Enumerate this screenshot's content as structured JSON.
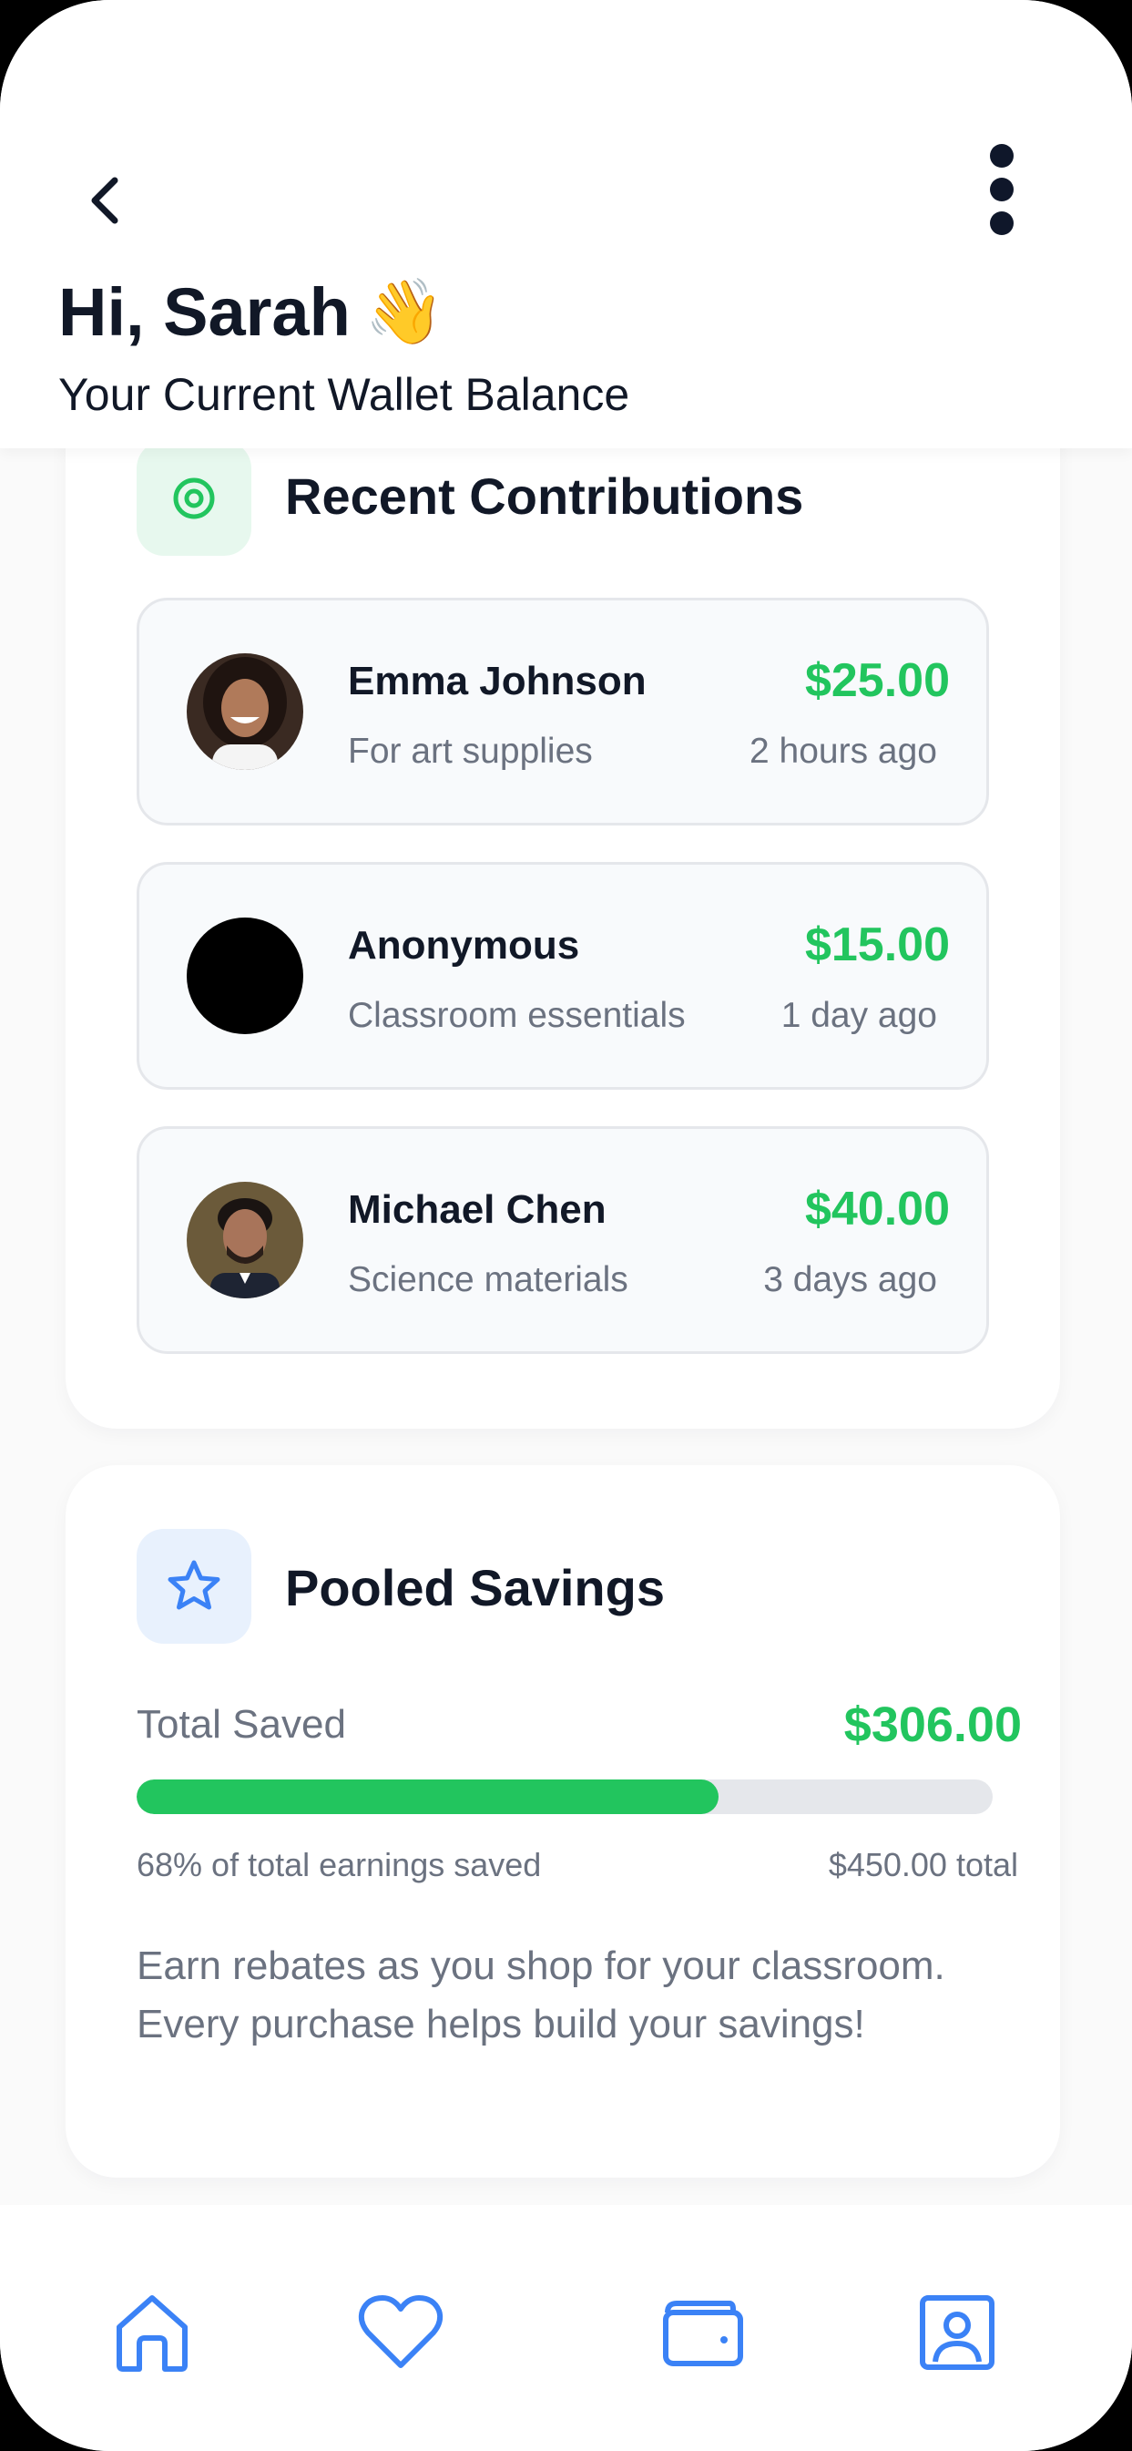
{
  "header": {
    "greeting": "Hi, Sarah",
    "wave_emoji": "👋",
    "subtitle": "Your Current Wallet Balance",
    "back_icon": "chevron-left-icon",
    "more_icon": "more-vertical-icon"
  },
  "contributions": {
    "title": "Recent Contributions",
    "icon": "target-icon",
    "items": [
      {
        "name": "Emma Johnson",
        "note": "For art supplies",
        "amount": "$25.00",
        "time": "2 hours ago",
        "avatar": "photo"
      },
      {
        "name": "Anonymous",
        "note": "Classroom essentials",
        "amount": "$15.00",
        "time": "1 day ago",
        "avatar": "anonymous"
      },
      {
        "name": "Michael Chen",
        "note": "Science materials",
        "amount": "$40.00",
        "time": "3 days ago",
        "avatar": "photo"
      }
    ]
  },
  "savings": {
    "title": "Pooled Savings",
    "icon": "star-icon",
    "total_label": "Total Saved",
    "total_amount": "$306.00",
    "progress_percent": 68,
    "progress_text": "68% of total earnings saved",
    "progress_total": "$450.00 total",
    "description": "Earn rebates as you shop for your classroom. Every purchase helps build your savings!"
  },
  "nav": [
    {
      "icon": "home-icon"
    },
    {
      "icon": "heart-icon"
    },
    {
      "icon": "wallet-icon"
    },
    {
      "icon": "profile-icon"
    }
  ],
  "colors": {
    "accent_green": "#22c55e",
    "accent_blue": "#3b82f6",
    "text_dark": "#111827",
    "text_muted": "#6b7280"
  }
}
